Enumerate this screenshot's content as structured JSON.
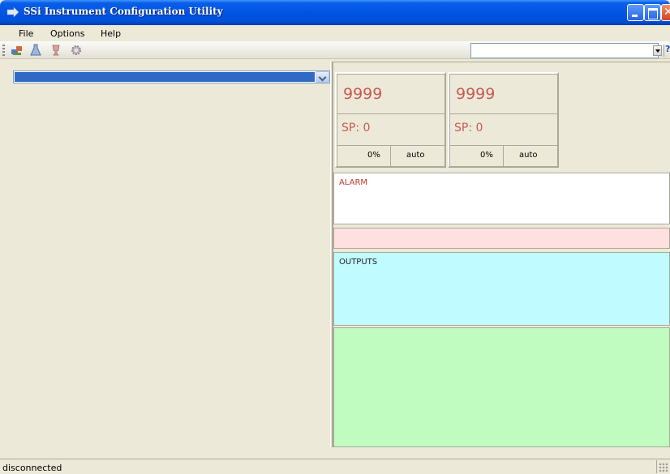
{
  "window": {
    "title": "SSi Instrument Configuration Utility",
    "icons": [
      "app-icon",
      "minimize-icon",
      "maximize-icon",
      "close-icon"
    ]
  },
  "menubar": {
    "items": [
      {
        "label": "File",
        "mnemonic": "F"
      },
      {
        "label": "Options",
        "mnemonic": "O"
      },
      {
        "label": "Help",
        "mnemonic": "H"
      }
    ]
  },
  "toolbar": {
    "buttons": [
      "connect-icon",
      "flask-icon",
      "trophy-icon",
      "gear-icon"
    ],
    "combo_value": "",
    "help_icon": "help-icon"
  },
  "left_panel": {
    "instrument_combo_value": ""
  },
  "loops": [
    {
      "pv": "9999",
      "sp": "SP: 0",
      "output": "0%",
      "mode": "auto"
    },
    {
      "pv": "9999",
      "sp": "SP: 0",
      "output": "0%",
      "mode": "auto"
    }
  ],
  "panels": {
    "alarm_label": "ALARM",
    "outputs_label": "OUTPUTS"
  },
  "status": {
    "text": "disconnected"
  },
  "colors": {
    "accent": "#0054e3",
    "pv_text": "#c85a52",
    "alarm_label": "#c0392b",
    "alarm_bg": "#ffffff",
    "pink_bg": "#ffe0e0",
    "outputs_bg": "#c0fbff",
    "green_bg": "#c0fcc0",
    "selection": "#316ac5"
  }
}
